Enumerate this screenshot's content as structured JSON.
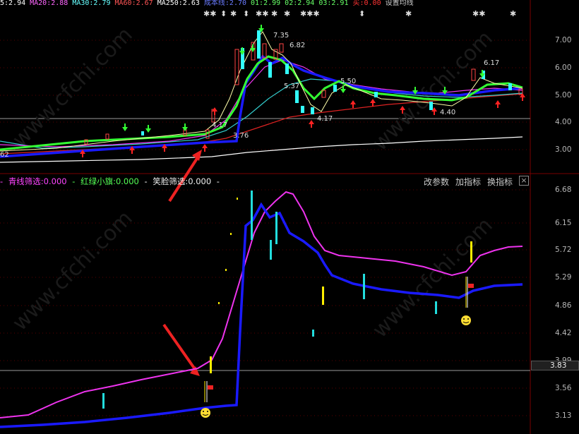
{
  "top_indicators": [
    {
      "label": "5:2.94",
      "color": "#ffffff"
    },
    {
      "label": "MA20:2.88",
      "color": "#ff66ff"
    },
    {
      "label": "MA30:2.79",
      "color": "#66ffff"
    },
    {
      "label": "MA60:2.67",
      "color": "#ff5555"
    },
    {
      "label": "MA250:2.63",
      "color": "#ffffff"
    },
    {
      "label": "成本线:2.70",
      "color": "#3355ff"
    },
    {
      "label": "01:2.99",
      "color": "#66ff66"
    },
    {
      "label": "02:2.94",
      "color": "#66ff66"
    },
    {
      "label": "03:2.91",
      "color": "#66ff66"
    },
    {
      "label": "买:0.00",
      "color": "#ff3333"
    },
    {
      "label": "设置均线",
      "color": "#cccccc"
    }
  ],
  "sub_indicators": [
    {
      "label": "青线筛选:0.000",
      "color": "#ff44ff"
    },
    {
      "label": "红绿小旗:0.000",
      "color": "#55ff55"
    },
    {
      "label": "笑脸筛选:0.000",
      "color": "#eeeeee"
    }
  ],
  "toolbar": {
    "params_label": "改参数",
    "add_indicator_label": "加指标",
    "change_indicator_label": "换指标",
    "close_label": "×"
  },
  "main_axis": [
    "7.00",
    "6.00",
    "5.00",
    "4.00",
    "3.00"
  ],
  "sub_axis": [
    "6.68",
    "6.15",
    "5.72",
    "5.29",
    "4.86",
    "4.42",
    "3.99",
    "3.56",
    "3.13"
  ],
  "current_price": "3.83",
  "annotations": {
    "high": "7.35",
    "high2": "6.82",
    "low_mid": "5.37",
    "p550": "5.50",
    "low417": "4.17",
    "p617": "6.17",
    "p440": "4.40",
    "p417b": "4.17",
    "p376": "3.76",
    "left62": "62"
  },
  "watermark": "www.cfchi.com",
  "colors": {
    "up": "#ff3333",
    "down": "#44ffff",
    "green": "#33ff33",
    "blue": "#1a1aff",
    "magenta": "#ee33ee",
    "yellow": "#ffee00",
    "cyan": "#22dddd",
    "grid": "#3a0000"
  }
}
